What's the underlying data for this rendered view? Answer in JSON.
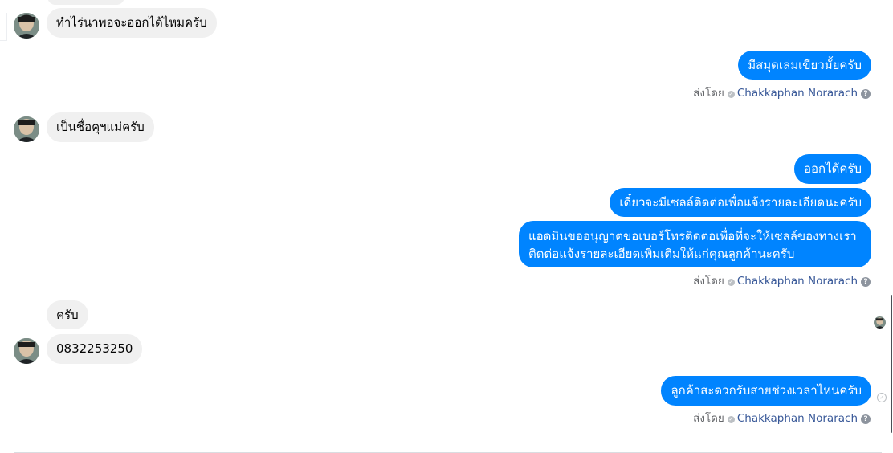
{
  "colors": {
    "outgoing_bubble": "#0084ff",
    "incoming_bubble": "#f0f0f0",
    "agent_link": "#385898",
    "meta_text": "#65676b"
  },
  "icons": {
    "avatar": "avatar-icon",
    "sent_check": "check-circle-icon",
    "help": "question-circle-icon",
    "seen": "seen-avatar-icon",
    "delivered": "delivered-check-icon"
  },
  "messages": {
    "m1": "ทำไร่นาพอจะออกได้ไหมครับ",
    "m2": "มีสมุดเล่มเขียวมั้ยครับ",
    "m3": "เป็นชื่อคุฯแม่ครับ",
    "m4": "ออกได้ครับ",
    "m5": "เดี๋ยวจะมีเซลล์ติดต่อเพื่อแจ้งรายละเอียดนะครับ",
    "m6": "แอดมินขออนุญาตขอเบอร์โทรติดต่อเพื่อที่จะให้เซลล์ของทางเราติดต่อแจ้งรายละเอียดเพิ่มเติมให้แก่คุณลูกค้านะครับ",
    "m7": "ครับ",
    "m8": "0832253250",
    "m9": "ลูกค้าสะดวกรับสายช่วงเวลาไหนครับ"
  },
  "sent_by": {
    "label": "ส่งโดย",
    "agent": "Chakkaphan Norarach"
  }
}
